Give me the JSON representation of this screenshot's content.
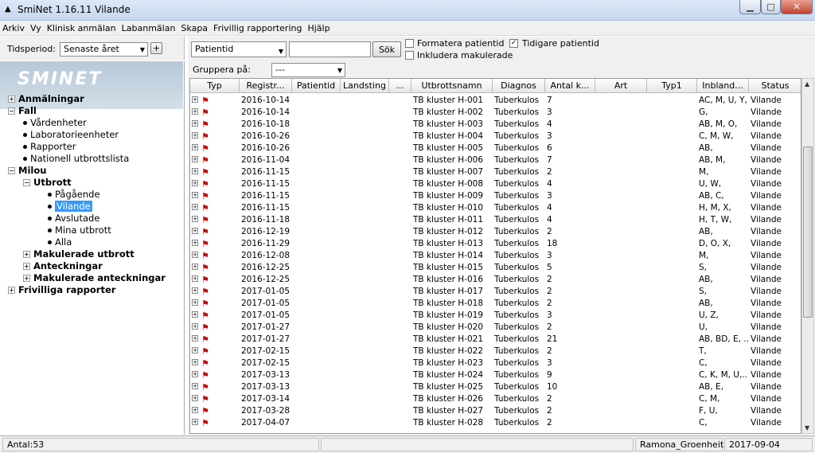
{
  "window": {
    "title": "SmiNet  1.16.11  Vilande",
    "min": "▁",
    "max": "□",
    "close": "✕"
  },
  "menu": [
    "Arkiv",
    "Vy",
    "Klinisk anmälan",
    "Labanmälan",
    "Skapa",
    "Frivillig rapportering",
    "Hjälp"
  ],
  "period": {
    "label": "Tidsperiod:",
    "value": "Senaste året",
    "plus": "+"
  },
  "logo": "SMINET",
  "tree": [
    {
      "label": "Anmälningar",
      "level": 0,
      "kind": "plus",
      "bold": true
    },
    {
      "label": "Fall",
      "level": 0,
      "kind": "minus",
      "bold": true
    },
    {
      "label": "Vårdenheter",
      "level": 1,
      "kind": "dot"
    },
    {
      "label": "Laboratorieenheter",
      "level": 1,
      "kind": "dot"
    },
    {
      "label": "Rapporter",
      "level": 1,
      "kind": "dot"
    },
    {
      "label": "Nationell utbrottslista",
      "level": 1,
      "kind": "dot"
    },
    {
      "label": "Milou",
      "level": 0,
      "kind": "minus",
      "bold": true
    },
    {
      "label": "Utbrott",
      "level": 1,
      "kind": "minus",
      "bold": true
    },
    {
      "label": "Pågående",
      "level": 2,
      "kind": "dot"
    },
    {
      "label": "Vilande",
      "level": 2,
      "kind": "dot",
      "selected": true
    },
    {
      "label": "Avslutade",
      "level": 2,
      "kind": "dot"
    },
    {
      "label": "Mina utbrott",
      "level": 2,
      "kind": "dot"
    },
    {
      "label": "Alla",
      "level": 2,
      "kind": "dot"
    },
    {
      "label": "Makulerade utbrott",
      "level": 1,
      "kind": "plus",
      "bold": true
    },
    {
      "label": "Anteckningar",
      "level": 1,
      "kind": "plus",
      "bold": true
    },
    {
      "label": "Makulerade anteckningar",
      "level": 1,
      "kind": "plus",
      "bold": true
    },
    {
      "label": "Frivilliga rapporter",
      "level": 0,
      "kind": "plus",
      "bold": true
    }
  ],
  "search": {
    "field": "Patientid",
    "query": "",
    "button": "Sök",
    "opt_format": "Formatera patientid",
    "opt_format_checked": false,
    "opt_earlier": "Tidigare patientid",
    "opt_earlier_checked": true,
    "opt_include": "Inkludera makulerade",
    "opt_include_checked": false
  },
  "grouping": {
    "label": "Gruppera på:",
    "value": "---"
  },
  "columns": [
    "Typ",
    "Registr...",
    "Patientid",
    "Landsting",
    "...",
    "Utbrottsnamn",
    "Diagnos",
    "Antal k...",
    "Art",
    "Typ1",
    "Inbland...",
    "Status"
  ],
  "rows": [
    [
      "2016-10-14",
      "TB kluster H-001",
      "Tuberkulos",
      "7",
      "AC, M, U, Y,",
      "Vilande"
    ],
    [
      "2016-10-14",
      "TB kluster H-002",
      "Tuberkulos",
      "3",
      "G,",
      "Vilande"
    ],
    [
      "2016-10-18",
      "TB kluster H-003",
      "Tuberkulos",
      "4",
      "AB, M, O,",
      "Vilande"
    ],
    [
      "2016-10-26",
      "TB kluster H-004",
      "Tuberkulos",
      "3",
      "C, M, W,",
      "Vilande"
    ],
    [
      "2016-10-26",
      "TB kluster H-005",
      "Tuberkulos",
      "6",
      "AB,",
      "Vilande"
    ],
    [
      "2016-11-04",
      "TB kluster H-006",
      "Tuberkulos",
      "7",
      "AB, M,",
      "Vilande"
    ],
    [
      "2016-11-15",
      "TB kluster H-007",
      "Tuberkulos",
      "2",
      "M,",
      "Vilande"
    ],
    [
      "2016-11-15",
      "TB kluster H-008",
      "Tuberkulos",
      "4",
      "U, W,",
      "Vilande"
    ],
    [
      "2016-11-15",
      "TB kluster H-009",
      "Tuberkulos",
      "3",
      "AB, C,",
      "Vilande"
    ],
    [
      "2016-11-15",
      "TB kluster H-010",
      "Tuberkulos",
      "4",
      "H, M, X,",
      "Vilande"
    ],
    [
      "2016-11-18",
      "TB kluster H-011",
      "Tuberkulos",
      "4",
      "H, T, W,",
      "Vilande"
    ],
    [
      "2016-12-19",
      "TB kluster H-012",
      "Tuberkulos",
      "2",
      "AB,",
      "Vilande"
    ],
    [
      "2016-11-29",
      "TB kluster H-013",
      "Tuberkulos",
      "18",
      "D, O, X,",
      "Vilande"
    ],
    [
      "2016-12-08",
      "TB kluster H-014",
      "Tuberkulos",
      "3",
      "M,",
      "Vilande"
    ],
    [
      "2016-12-25",
      "TB kluster H-015",
      "Tuberkulos",
      "5",
      "S,",
      "Vilande"
    ],
    [
      "2016-12-25",
      "TB kluster H-016",
      "Tuberkulos",
      "2",
      "AB,",
      "Vilande"
    ],
    [
      "2017-01-05",
      "TB kluster H-017",
      "Tuberkulos",
      "2",
      "S,",
      "Vilande"
    ],
    [
      "2017-01-05",
      "TB kluster H-018",
      "Tuberkulos",
      "2",
      "AB,",
      "Vilande"
    ],
    [
      "2017-01-05",
      "TB kluster H-019",
      "Tuberkulos",
      "3",
      "U, Z,",
      "Vilande"
    ],
    [
      "2017-01-27",
      "TB kluster H-020",
      "Tuberkulos",
      "2",
      "U,",
      "Vilande"
    ],
    [
      "2017-01-27",
      "TB kluster H-021",
      "Tuberkulos",
      "21",
      "AB, BD, E, ...",
      "Vilande"
    ],
    [
      "2017-02-15",
      "TB kluster H-022",
      "Tuberkulos",
      "2",
      "T,",
      "Vilande"
    ],
    [
      "2017-02-15",
      "TB kluster H-023",
      "Tuberkulos",
      "3",
      "C,",
      "Vilande"
    ],
    [
      "2017-03-13",
      "TB kluster H-024",
      "Tuberkulos",
      "9",
      "C, K, M, U,...",
      "Vilande"
    ],
    [
      "2017-03-13",
      "TB kluster H-025",
      "Tuberkulos",
      "10",
      "AB, E,",
      "Vilande"
    ],
    [
      "2017-03-14",
      "TB kluster H-026",
      "Tuberkulos",
      "2",
      "C, M,",
      "Vilande"
    ],
    [
      "2017-03-28",
      "TB kluster H-027",
      "Tuberkulos",
      "2",
      "F, U,",
      "Vilande"
    ],
    [
      "2017-04-07",
      "TB kluster H-028",
      "Tuberkulos",
      "2",
      "C,",
      "Vilande"
    ]
  ],
  "status": {
    "count": "Antal:53",
    "user": "Ramona_Groenheit",
    "date": "2017-09-04"
  }
}
